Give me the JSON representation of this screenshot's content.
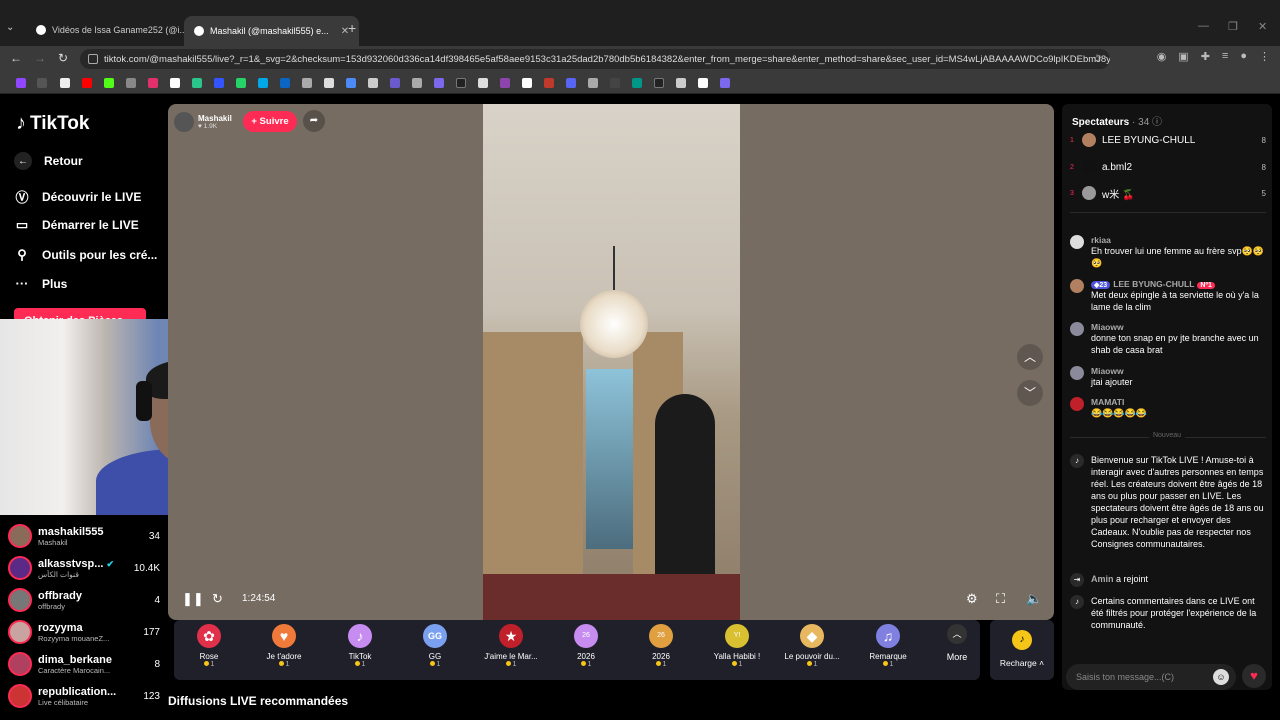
{
  "browser": {
    "tabs": [
      {
        "title": "Vidéos de Issa Ganame252 (@i..."
      },
      {
        "title": "Mashakil (@mashakil555) e..."
      }
    ],
    "url": "tiktok.com/@mashakil555/live?_r=1&_svg=2&checksum=153d932060d336ca14df398465e5af58aee9153c31a25dad2b780db5b6184382&enter_from_merge=share&enter_method=share&sec_user_id=MS4wLjABAAAAWDCo9lpIKDEbmJ8y..."
  },
  "sidebar": {
    "logo": "TikTok",
    "back": "Retour",
    "items": [
      {
        "label": "Découvrir le LIVE",
        "icon": "live-discover-icon"
      },
      {
        "label": "Démarrer le LIVE",
        "icon": "camera-icon"
      },
      {
        "label": "Outils pour les cré...",
        "icon": "tools-icon"
      },
      {
        "label": "Plus",
        "icon": "more-dots-icon"
      }
    ],
    "login_label": "Obtenir des Pièces"
  },
  "creators": [
    {
      "name": "mashakil555",
      "sub": "Mashakil",
      "count": "34"
    },
    {
      "name": "alkasstvsp...",
      "sub": "قنوات الكأس",
      "count": "10.4K"
    },
    {
      "name": "offbrady",
      "sub": "offbrady",
      "count": "4"
    },
    {
      "name": "rozyyma",
      "sub": "Rozyyma mouaneZ...",
      "count": "177"
    },
    {
      "name": "dima_berkane",
      "sub": "Caractère Marocain...",
      "count": "8"
    },
    {
      "name": "republication...",
      "sub": "Live célibataire",
      "count": "123"
    }
  ],
  "player": {
    "host_name": "Mashakil",
    "host_likes": "1.9K",
    "follow_label": "+ Suivre",
    "timecode": "1:24:54"
  },
  "gifts": [
    {
      "label": "Rose",
      "cost": "1",
      "color": "#e0304a",
      "icon": "rose-icon"
    },
    {
      "label": "Je t'adore",
      "cost": "1",
      "color": "#f07a3a",
      "icon": "heart-hand-icon"
    },
    {
      "label": "TikTok",
      "cost": "1",
      "color": "#c78cf0",
      "icon": "tiktok-gift-icon"
    },
    {
      "label": "GG",
      "cost": "1",
      "color": "#7aa0f0",
      "icon": "gg-icon"
    },
    {
      "label": "J'aime le Mar...",
      "cost": "1",
      "color": "#c0202a",
      "icon": "morocco-heart-icon"
    },
    {
      "label": "2026",
      "cost": "1",
      "color": "#c78cf0",
      "icon": "2026-icon"
    },
    {
      "label": "2026",
      "cost": "1",
      "color": "#e0a040",
      "icon": "2026-gold-icon"
    },
    {
      "label": "Yalla Habibi !",
      "cost": "1",
      "color": "#d8c030",
      "icon": "yalla-icon"
    },
    {
      "label": "Le pouvoir du...",
      "cost": "1",
      "color": "#e8b860",
      "icon": "diamond-icon"
    },
    {
      "label": "Remarque",
      "cost": "1",
      "color": "#8080e0",
      "icon": "note-icon"
    }
  ],
  "more_label": "More",
  "recharge_label": "Recharge",
  "recommended_title": "Diffusions LIVE recommandées",
  "chat": {
    "viewers_label": "Spectateurs",
    "viewers_count": "· 34",
    "top_viewers": [
      {
        "rank": "1",
        "name": "LEE BYUNG-CHULL",
        "points": "8"
      },
      {
        "rank": "2",
        "name": "a.bml2",
        "points": "8"
      },
      {
        "rank": "3",
        "name": "w米 🍒",
        "points": "5"
      }
    ],
    "messages": [
      {
        "user": "rkiaa",
        "text": "Eh trouver lui une femme au frère svp🥺🥺🥺"
      },
      {
        "user": "LEE BYUNG-CHULL",
        "level": "23",
        "rank_badge": "Nº1",
        "text": "Met deux épingle à ta serviette le où y'a la lame de la clim"
      },
      {
        "user": "Miaoww",
        "text": "donne ton snap en pv jte branche avec un shab de casa brat"
      },
      {
        "user": "Miaoww",
        "text": "jtai ajouter"
      },
      {
        "user": "MAMATI",
        "text": "😂😂😂😂😂"
      }
    ],
    "new_label": "Nouveau",
    "welcome": "Bienvenue sur TikTok LIVE ! Amuse-toi à interagir avec d'autres personnes en temps réel. Les créateurs doivent être âgés de 18 ans ou plus pour passer en LIVE. Les spectateurs doivent être âgés de 18 ans ou plus pour recharger et envoyer des Cadeaux. N'oublie pas de respecter nos Consignes communautaires.",
    "joined_user": "Amin",
    "joined_text": "a rejoint",
    "filtered": "Certains commentaires dans ce LIVE ont été filtrés pour protéger l'expérience de la communauté.",
    "input_placeholder": "Saisis ton message...(C)"
  }
}
